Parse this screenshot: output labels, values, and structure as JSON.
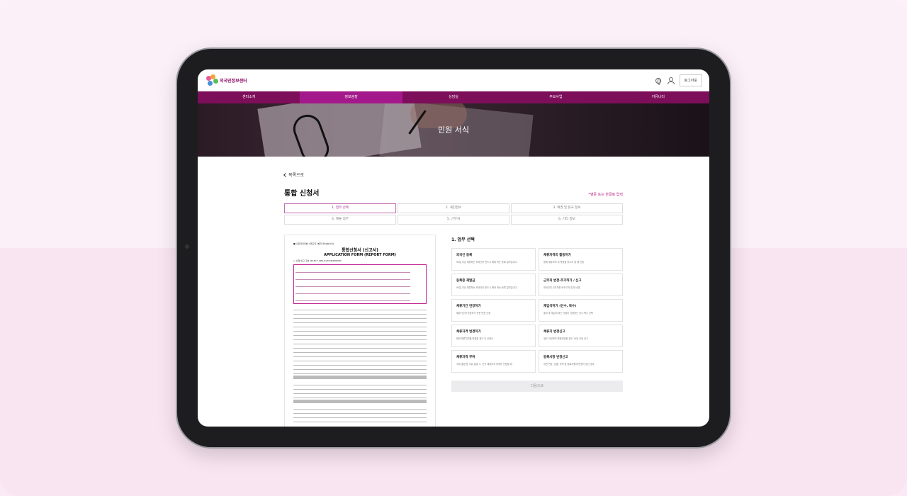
{
  "site": {
    "logo_text": "외국인정보센터"
  },
  "header": {
    "login_label": "로그아웃",
    "globe_icon": "globe-icon",
    "user_icon": "user-icon"
  },
  "nav": [
    {
      "label": "센터소개",
      "active": false
    },
    {
      "label": "정보광장",
      "active": true
    },
    {
      "label": "상담실",
      "active": false
    },
    {
      "label": "주요사업",
      "active": false
    },
    {
      "label": "커뮤니티",
      "active": false
    }
  ],
  "hero": {
    "title": "민원 서식"
  },
  "content": {
    "back_label": "목록으로",
    "page_title": "통합 신청서",
    "lang_note": "*영문 또는 한글로 입력",
    "steps": [
      {
        "label": "1. 업무 선택",
        "active": true
      },
      {
        "label": "2. 개인정보",
        "active": false
      },
      {
        "label": "3. 여권 및 본국 정보",
        "active": false
      },
      {
        "label": "4. 체류 의무",
        "active": false
      },
      {
        "label": "5. 근무처",
        "active": false
      },
      {
        "label": "6. 기타 정보",
        "active": false
      }
    ],
    "form_preview": {
      "top_note": "■ 출입국관리법 시행규칙 [별지 제34호서식]",
      "title_ko": "통합신청서 (신고서)",
      "title_en": "APPLICATION FORM (REPORT FORM)",
      "section": "□ 신청/신고 구분 SELECT APPLICATION/REPORT"
    },
    "section_title": "1. 업무 선택",
    "cards": [
      {
        "title": "외국인 등록",
        "desc": "90일 이상 체류하는 외국인이 반드시 해야 하는 등록 절차입니다."
      },
      {
        "title": "체류자격외 활동허가",
        "desc": "원래 체류자격 외 활동을 하고자 할 때 신청"
      },
      {
        "title": "등록증 재발급",
        "desc": "90일 이상 체류하는 외국인이 반드시 해야 하는 등록 절차입니다."
      },
      {
        "title": "근무처 변경·추가허가 / 신고",
        "desc": "외국인이 근무처를 바꾸고자 할 때 신청"
      },
      {
        "title": "체류기간 연장허가",
        "desc": "체류기간의 연장허가 관한 민원 신청"
      },
      {
        "title": "재입국허가 (단수, 복수)",
        "desc": "출국 후 재입국 하는 사람이 신청하는 단수·복수 선택"
      },
      {
        "title": "체류자격 변경허가",
        "desc": "현재 체류자격을 변경할 경우 이 신청서"
      },
      {
        "title": "체류지 변경신고",
        "desc": "새로 이전하여 변경하였을 경우 14일 이내 신고"
      },
      {
        "title": "체류자격 부여",
        "desc": "국내 출생 등 사유 발생 시, 신규 체류자격 부여를 신청할 때"
      },
      {
        "title": "등록사항 변경신고",
        "desc": "여권 번호, 성별, 국적 등 등록사항에 변경이 생긴 경우"
      }
    ],
    "next_label": "다음으로"
  },
  "colors": {
    "brand": "#7d0e5a",
    "nav_active": "#a3198b",
    "accent": "#b5157a"
  }
}
